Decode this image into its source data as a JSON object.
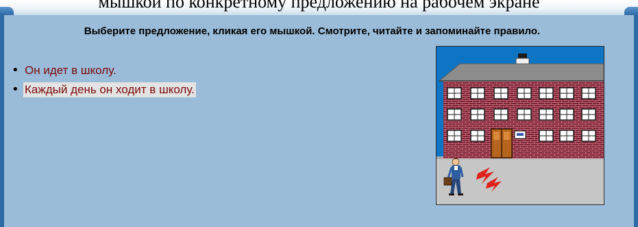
{
  "header": {
    "top_text": "мышкой по конкретному предложению на рабочем экране"
  },
  "panel": {
    "instruction": "Выберите предложение, кликая его мышкой. Смотрите, читайте и запоминайте правило."
  },
  "sentences": [
    {
      "text": "Он идет в школу.",
      "selected": false
    },
    {
      "text": "Каждый день он ходит в школу.",
      "selected": true
    }
  ],
  "illustration": {
    "subject": "school-building-with-man-walking",
    "colors": {
      "sky": "#0e75c4",
      "roof": "#8c8c8c",
      "brick": "#7a2436",
      "door": "#b5651d",
      "ground": "#c6c6c6",
      "lightning": "#e0201a"
    }
  },
  "colors": {
    "panel_bg": "#9bbcd8",
    "panel_border": "#2e6aa6",
    "sentence_text": "#7a0a0a",
    "selected_bg": "#e3e3e3"
  }
}
